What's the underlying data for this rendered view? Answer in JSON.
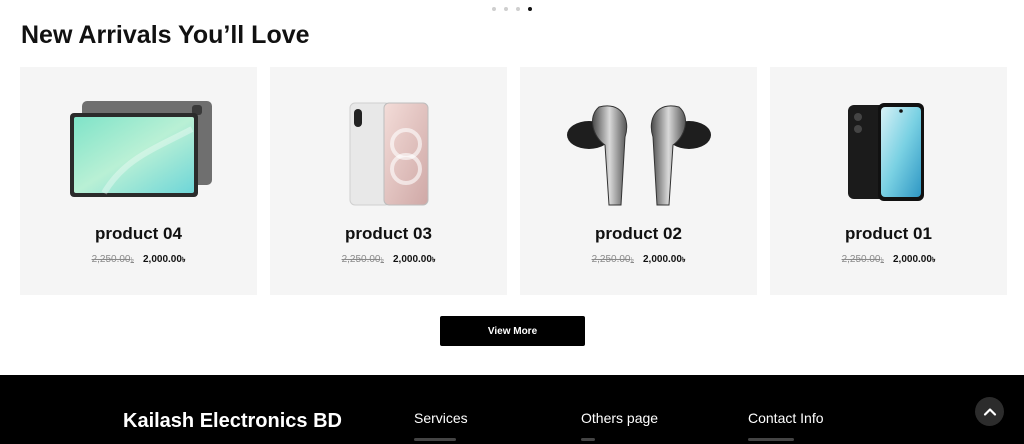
{
  "carousel": {
    "dots": 4,
    "active_index": 3
  },
  "section": {
    "title": "New Arrivals You’ll Love"
  },
  "products": [
    {
      "name": "product 04",
      "old_price": "2,250.00",
      "price": "2,000.00",
      "currency": "৳",
      "image_icon": "tablet-icon"
    },
    {
      "name": "product 03",
      "old_price": "2,250.00",
      "price": "2,000.00",
      "currency": "৳",
      "image_icon": "foldable-phone-icon"
    },
    {
      "name": "product 02",
      "old_price": "2,250.00",
      "price": "2,000.00",
      "currency": "৳",
      "image_icon": "earbuds-icon"
    },
    {
      "name": "product 01",
      "old_price": "2,250.00",
      "price": "2,000.00",
      "currency": "৳",
      "image_icon": "smartphone-icon"
    }
  ],
  "view_more_label": "View More",
  "footer": {
    "brand": "Kailash Electronics BD",
    "columns": [
      {
        "title": "Services"
      },
      {
        "title": "Others page"
      },
      {
        "title": "Contact Info"
      }
    ]
  },
  "colors": {
    "card_bg": "#f5f5f5",
    "footer_bg": "#000000",
    "button_bg": "#000000"
  }
}
